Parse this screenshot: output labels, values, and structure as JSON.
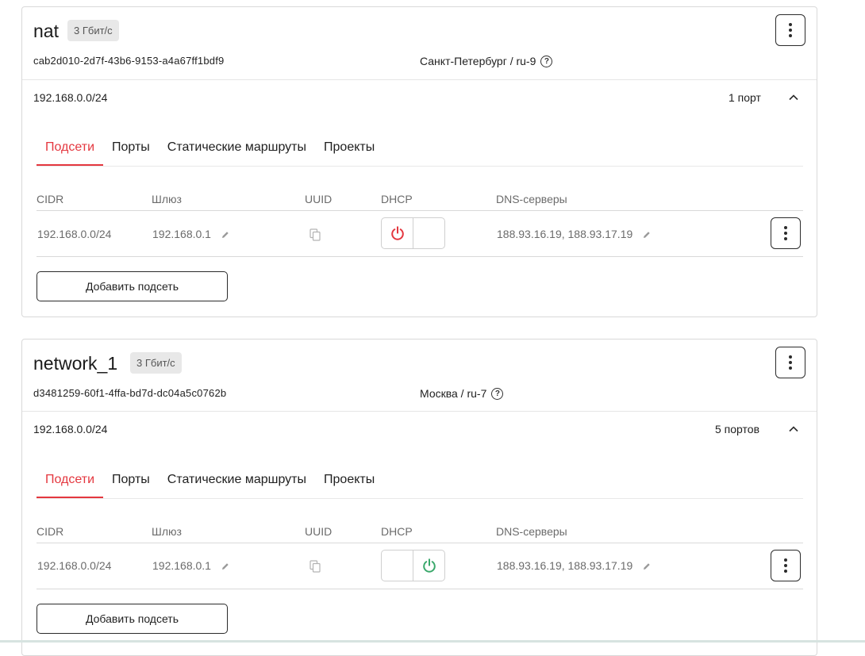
{
  "networks": [
    {
      "name": "nat",
      "speed": "3 Гбит/с",
      "uuid": "cab2d010-2d7f-43b6-9153-a4a67ff1bdf9",
      "region": "Санкт-Петербург / ru-9",
      "subnet": "192.168.0.0/24",
      "ports": "1 порт",
      "tabs": [
        "Подсети",
        "Порты",
        "Статические маршруты",
        "Проекты"
      ],
      "active_tab": "Подсети",
      "columns": [
        "CIDR",
        "Шлюз",
        "UUID",
        "DHCP",
        "DNS-серверы"
      ],
      "row": {
        "cidr": "192.168.0.0/24",
        "gateway": "192.168.0.1",
        "dhcp": "off",
        "dns": "188.93.16.19, 188.93.17.19"
      },
      "add_subnet_label": "Добавить подсеть"
    },
    {
      "name": "network_1",
      "speed": "3 Гбит/с",
      "uuid": "d3481259-60f1-4ffa-bd7d-dc04a5c0762b",
      "region": "Москва / ru-7",
      "subnet": "192.168.0.0/24",
      "ports": "5 портов",
      "tabs": [
        "Подсети",
        "Порты",
        "Статические маршруты",
        "Проекты"
      ],
      "active_tab": "Подсети",
      "columns": [
        "CIDR",
        "Шлюз",
        "UUID",
        "DHCP",
        "DNS-серверы"
      ],
      "row": {
        "cidr": "192.168.0.0/24",
        "gateway": "192.168.0.1",
        "dhcp": "on",
        "dns": "188.93.16.19, 188.93.17.19"
      },
      "add_subnet_label": "Добавить подсеть"
    }
  ],
  "icons": {
    "help": "question-circle-icon",
    "menu": "kebab-menu-icon",
    "chevron": "chevron-up-icon",
    "edit": "pencil-icon",
    "copy": "copy-icon",
    "power": "power-icon"
  },
  "colors": {
    "accent": "#e4373f",
    "dhcp_on": "#3aa86b",
    "dhcp_off": "#e4373f"
  }
}
